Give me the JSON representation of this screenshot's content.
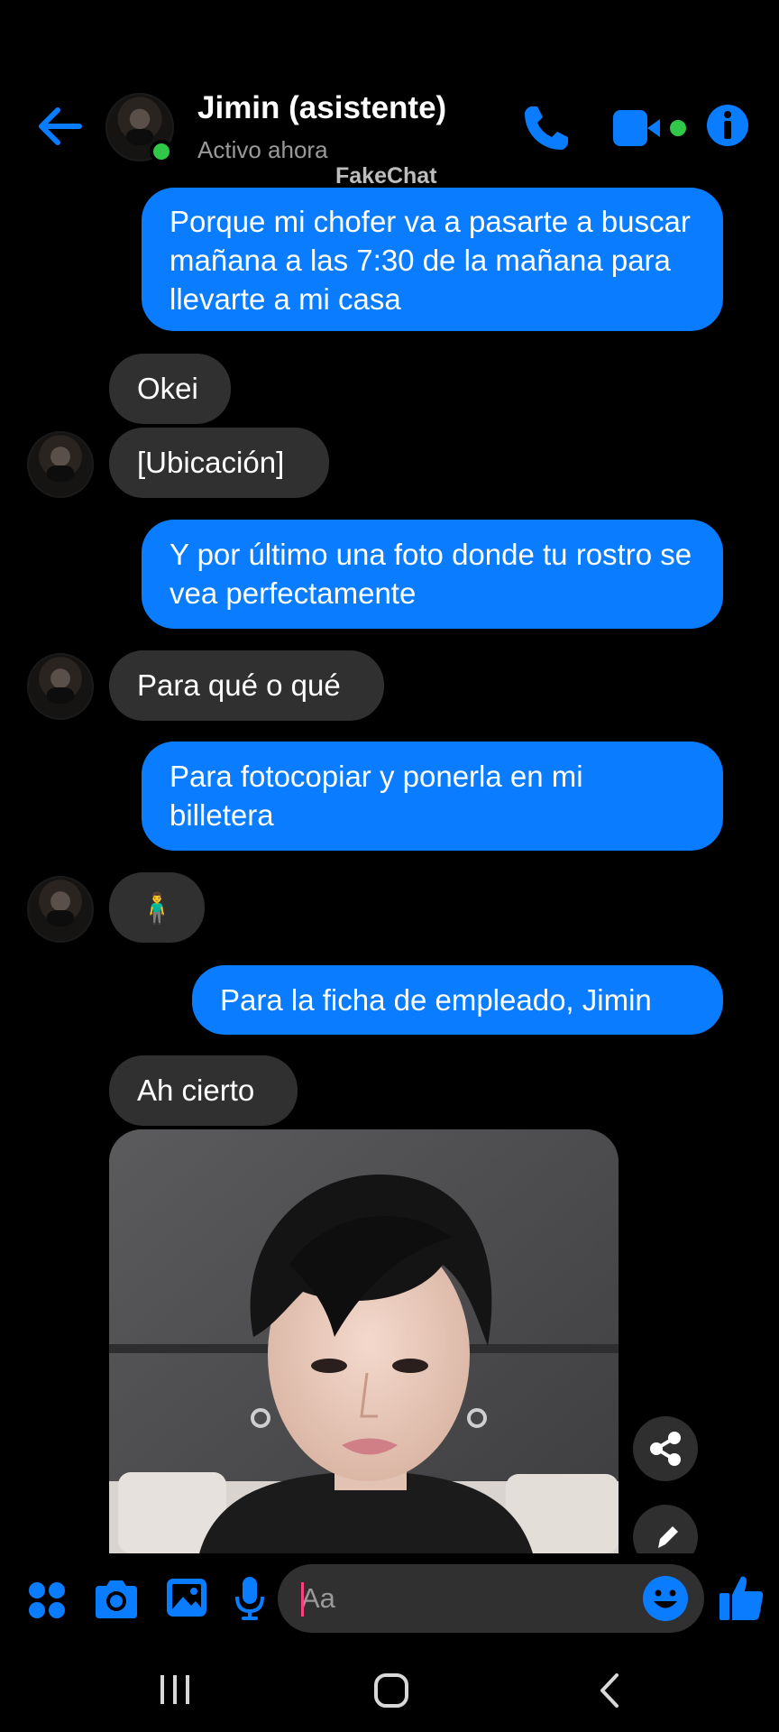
{
  "header": {
    "contact_name": "Jimin (asistente)",
    "status": "Activo ahora",
    "watermark": "FakeChat"
  },
  "colors": {
    "accent": "#0a7cff",
    "incoming_bubble": "#303030",
    "online": "#31c748",
    "background": "#000000"
  },
  "messages": [
    {
      "from": "me",
      "text": "Porque mi chofer va a pasarte a buscar mañana a las 7:30 de la mañana para llevarte a mi casa"
    },
    {
      "from": "them",
      "text": "Okei"
    },
    {
      "from": "them",
      "text": "[Ubicación]"
    },
    {
      "from": "me",
      "text": "Y por último una foto donde tu rostro se vea perfectamente"
    },
    {
      "from": "them",
      "text": "Para qué o qué"
    },
    {
      "from": "me",
      "text": "Para fotocopiar y ponerla en mi billetera"
    },
    {
      "from": "them",
      "text": "🧍‍♂️"
    },
    {
      "from": "me",
      "text": "Para la ficha de empleado, Jimin"
    },
    {
      "from": "them",
      "text": "Ah cierto"
    }
  ],
  "composer": {
    "placeholder": "Aa"
  },
  "icons": {
    "header": [
      "back-arrow-icon",
      "phone-icon",
      "video-camera-icon",
      "info-icon"
    ],
    "photo_actions": [
      "share-icon",
      "edit-pencil-icon"
    ],
    "composer": [
      "apps-icon",
      "camera-icon",
      "image-icon",
      "microphone-icon",
      "emoji-icon",
      "thumbs-up-icon"
    ],
    "system_nav": [
      "recent-apps-icon",
      "home-icon",
      "back-icon"
    ]
  }
}
